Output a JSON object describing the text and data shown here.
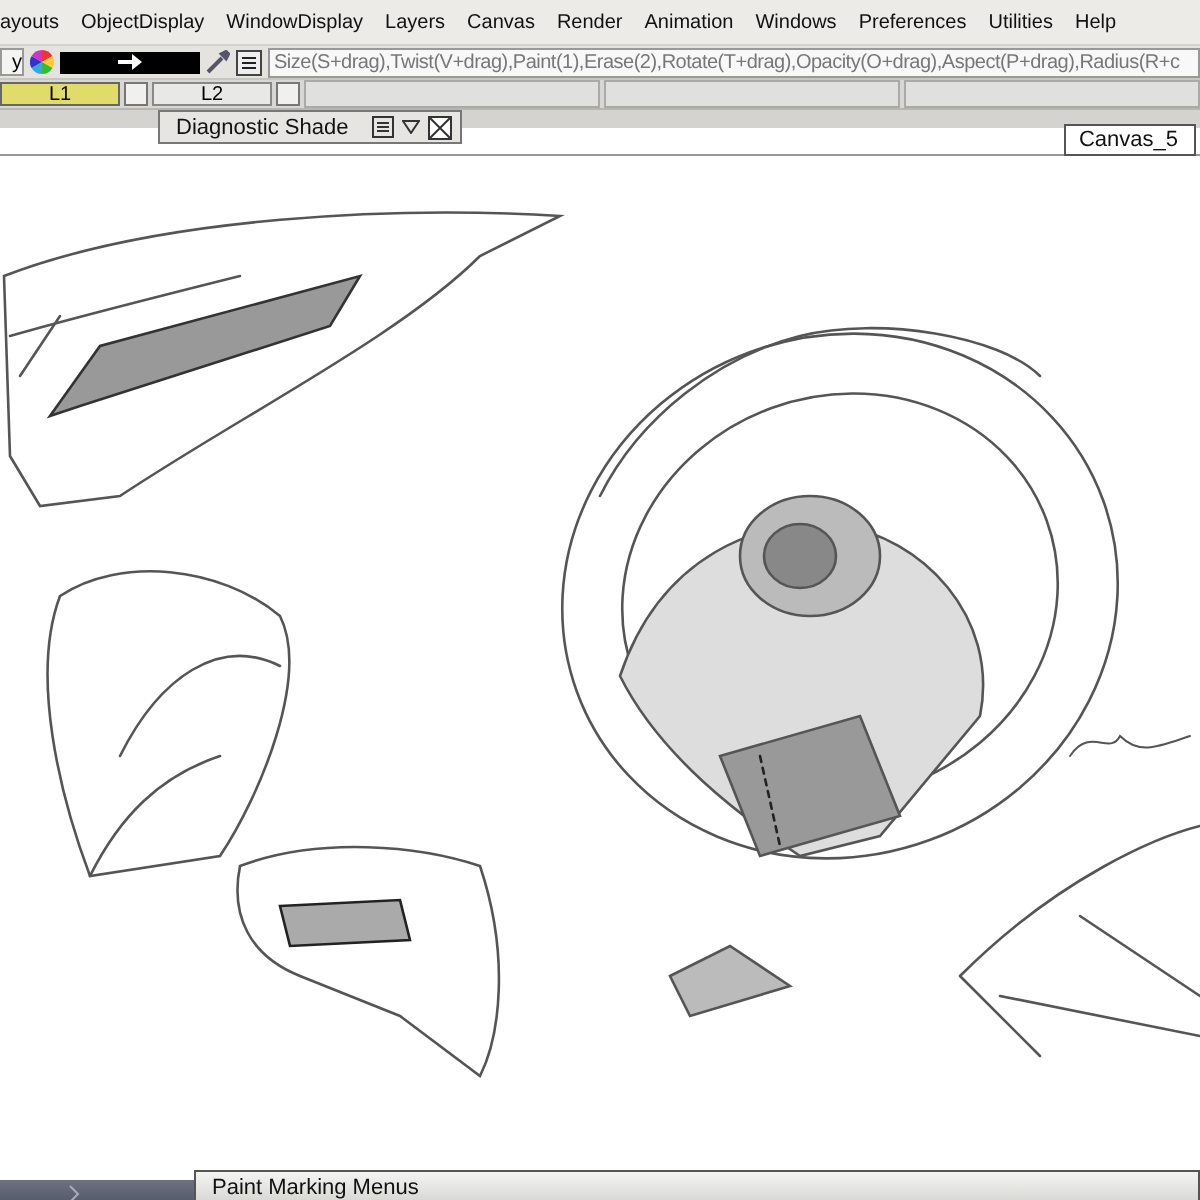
{
  "menu_bar": [
    "ayouts",
    "ObjectDisplay",
    "WindowDisplay",
    "Layers",
    "Canvas",
    "Render",
    "Animation",
    "Windows",
    "Preferences",
    "Utilities",
    "Help"
  ],
  "toolbar": {
    "cut_button": "y",
    "brush_hint": "Size(S+drag),Twist(V+drag),Paint(1),Erase(2),Rotate(T+drag),Opacity(O+drag),Aspect(P+drag),Radius(R+c"
  },
  "layers": [
    {
      "label": "L1",
      "selected": true,
      "checked": false
    },
    {
      "label": "L2",
      "selected": false,
      "checked": false
    }
  ],
  "floating_panel": {
    "title": "Diagnostic Shade"
  },
  "canvas": {
    "name": "Canvas_5"
  },
  "bottom_panel": {
    "title": "Paint Marking Menus"
  }
}
